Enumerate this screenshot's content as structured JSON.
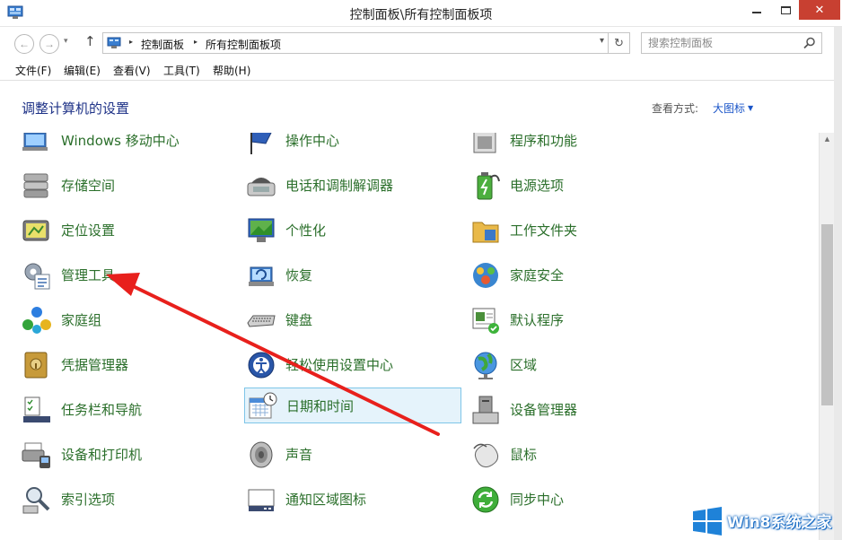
{
  "window": {
    "title": "控制面板\\所有控制面板项",
    "close_glyph": "✕"
  },
  "nav": {
    "back_glyph": "←",
    "forward_glyph": "→",
    "recent_glyph": "▾",
    "up_glyph": "↑",
    "breadcrumbs": [
      "控制面板",
      "所有控制面板项"
    ],
    "breadcrumb_sep": "▸",
    "dropdown_glyph": "▾",
    "refresh_glyph": "↻",
    "search_placeholder": "搜索控制面板"
  },
  "menu": [
    "文件(F)",
    "编辑(E)",
    "查看(V)",
    "工具(T)",
    "帮助(H)"
  ],
  "header": {
    "title": "调整计算机的设置",
    "view_label": "查看方式:",
    "view_value": "大图标"
  },
  "columns": [
    [
      "Windows 移动中心",
      "存储空间",
      "定位设置",
      "管理工具",
      "家庭组",
      "凭据管理器",
      "任务栏和导航",
      "设备和打印机",
      "索引选项"
    ],
    [
      "操作中心",
      "电话和调制解调器",
      "个性化",
      "恢复",
      "键盘",
      "轻松使用设置中心",
      "日期和时间",
      "声音",
      "通知区域图标"
    ],
    [
      "程序和功能",
      "电源选项",
      "工作文件夹",
      "家庭安全",
      "默认程序",
      "区域",
      "设备管理器",
      "鼠标",
      "同步中心"
    ]
  ],
  "selected_item": "日期和时间",
  "watermark": {
    "text": "Win8系统之家"
  },
  "colors": {
    "title_text": "#1e3287",
    "item_text": "#2b6f2b",
    "link": "#1a55c8",
    "close_button": "#c84031",
    "selection_bg": "#e5f3fb",
    "selection_border": "#7ec5e8",
    "arrow": "#e8201c"
  },
  "scroll": {
    "position": 0.37
  }
}
